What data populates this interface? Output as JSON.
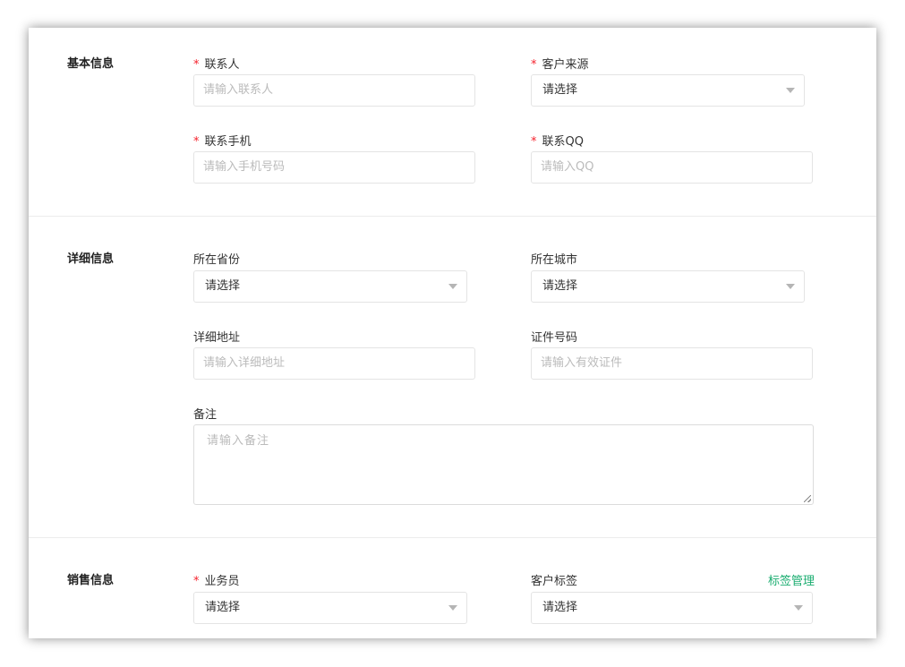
{
  "sections": {
    "basic": {
      "title": "基本信息",
      "contact": {
        "label": "联系人",
        "placeholder": "请输入联系人"
      },
      "source": {
        "label": "客户来源",
        "value": "请选择"
      },
      "phone": {
        "label": "联系手机",
        "placeholder": "请输入手机号码"
      },
      "qq": {
        "label": "联系QQ",
        "placeholder": "请输入QQ"
      }
    },
    "detail": {
      "title": "详细信息",
      "province": {
        "label": "所在省份",
        "value": "请选择"
      },
      "city": {
        "label": "所在城市",
        "value": "请选择"
      },
      "address": {
        "label": "详细地址",
        "placeholder": "请输入详细地址"
      },
      "id_number": {
        "label": "证件号码",
        "placeholder": "请输入有效证件"
      },
      "remark": {
        "label": "备注",
        "placeholder": "请输入备注"
      }
    },
    "sales": {
      "title": "销售信息",
      "salesperson": {
        "label": "业务员",
        "value": "请选择"
      },
      "tags": {
        "label": "客户标签",
        "value": "请选择",
        "manage_link": "标签管理"
      }
    }
  },
  "required_mark": "*",
  "colors": {
    "required": "#f5222d",
    "link": "#1aad70",
    "border": "#e4e4e4",
    "placeholder": "#bbbbbb"
  }
}
